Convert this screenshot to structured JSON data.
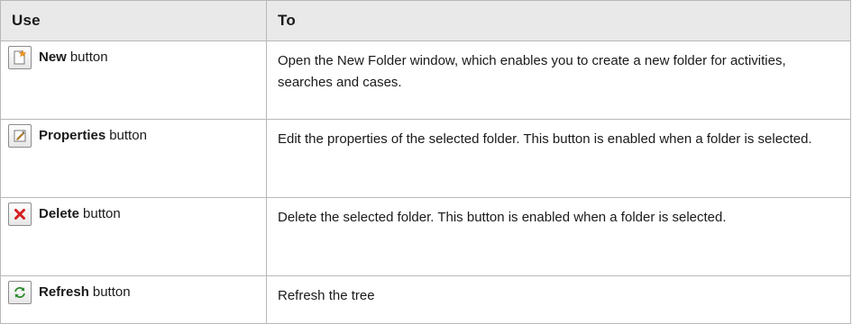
{
  "table": {
    "header": {
      "use": "Use",
      "to": "To"
    },
    "rows": [
      {
        "icon": "new-folder-icon",
        "name": "New",
        "suffix": "button",
        "description": "Open the New Folder window, which enables you to create a new folder for activities, searches and cases."
      },
      {
        "icon": "properties-icon",
        "name": "Properties",
        "suffix": "button",
        "description": "Edit the properties of the selected folder. This button is enabled when a folder is selected."
      },
      {
        "icon": "delete-icon",
        "name": "Delete",
        "suffix": "button",
        "description": "Delete the selected folder. This button is enabled when a folder is selected."
      },
      {
        "icon": "refresh-icon",
        "name": "Refresh",
        "suffix": "button",
        "description": "Refresh the tree"
      }
    ]
  },
  "colors": {
    "header_bg": "#e9e9e9",
    "border": "#b8b8b8",
    "delete_icon": "#d62020",
    "refresh_icon": "#2e8b2e",
    "new_icon_star": "#f0a020"
  }
}
